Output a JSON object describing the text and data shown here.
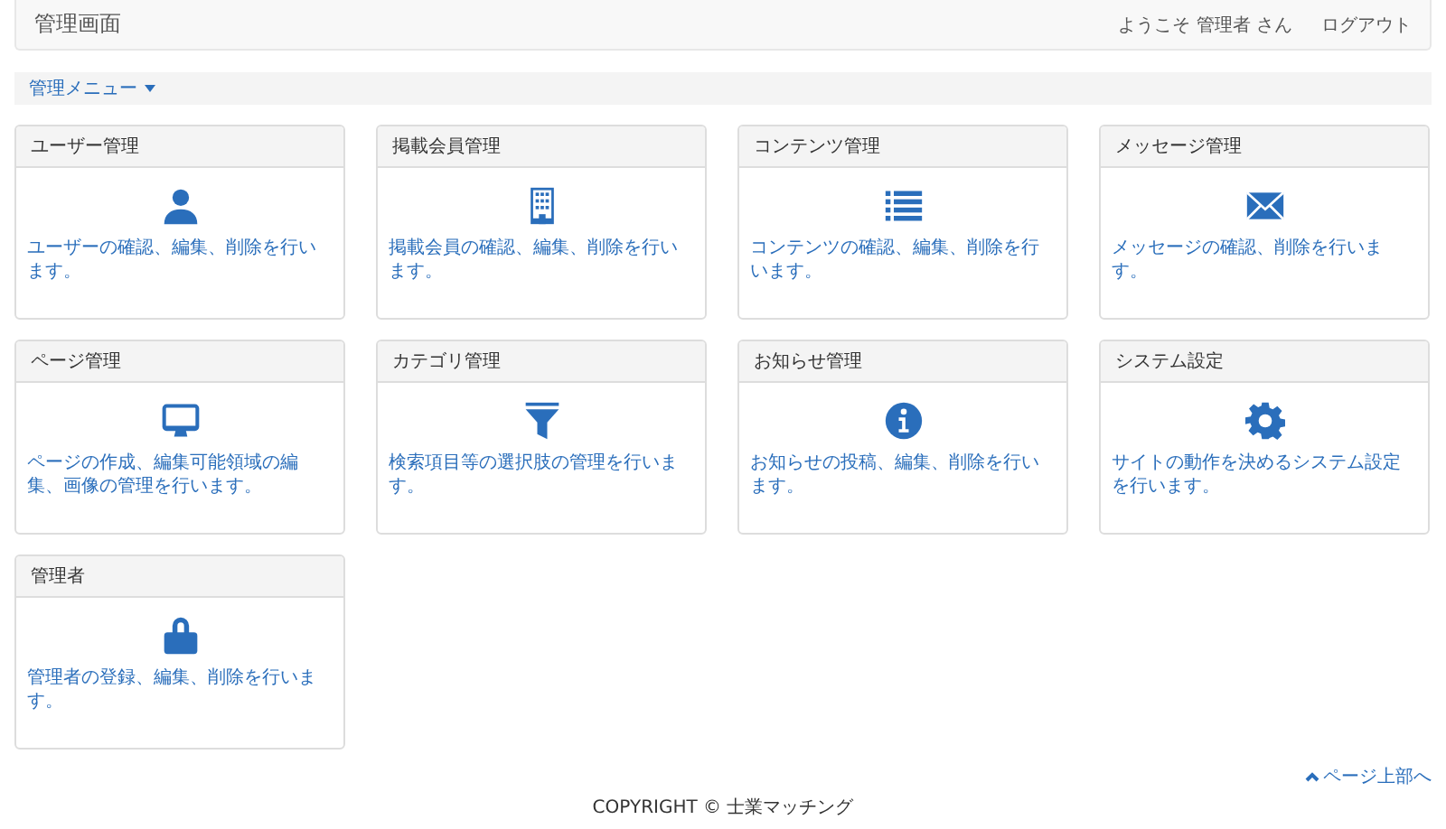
{
  "header": {
    "title": "管理画面",
    "welcome": "ようこそ 管理者 さん",
    "logout": "ログアウト"
  },
  "menu": {
    "label": "管理メニュー"
  },
  "cards": [
    {
      "title": "ユーザー管理",
      "kind": "user",
      "description": "ユーザーの確認、編集、削除を行います。"
    },
    {
      "title": "掲載会員管理",
      "kind": "building",
      "description": "掲載会員の確認、編集、削除を行います。"
    },
    {
      "title": "コンテンツ管理",
      "kind": "list",
      "description": "コンテンツの確認、編集、削除を行います。"
    },
    {
      "title": "メッセージ管理",
      "kind": "mail",
      "description": "メッセージの確認、削除を行います。"
    },
    {
      "title": "ページ管理",
      "kind": "monitor",
      "description": "ページの作成、編集可能領域の編集、画像の管理を行います。"
    },
    {
      "title": "カテゴリ管理",
      "kind": "filter",
      "description": "検索項目等の選択肢の管理を行います。"
    },
    {
      "title": "お知らせ管理",
      "kind": "info",
      "description": "お知らせの投稿、編集、削除を行います。"
    },
    {
      "title": "システム設定",
      "kind": "gear",
      "description": "サイトの動作を決めるシステム設定を行います。"
    },
    {
      "title": "管理者",
      "kind": "lock",
      "description": "管理者の登録、編集、削除を行います。"
    }
  ],
  "page_top": "ページ上部へ",
  "footer": {
    "copyright": "COPYRIGHT © 士業マッチング"
  }
}
